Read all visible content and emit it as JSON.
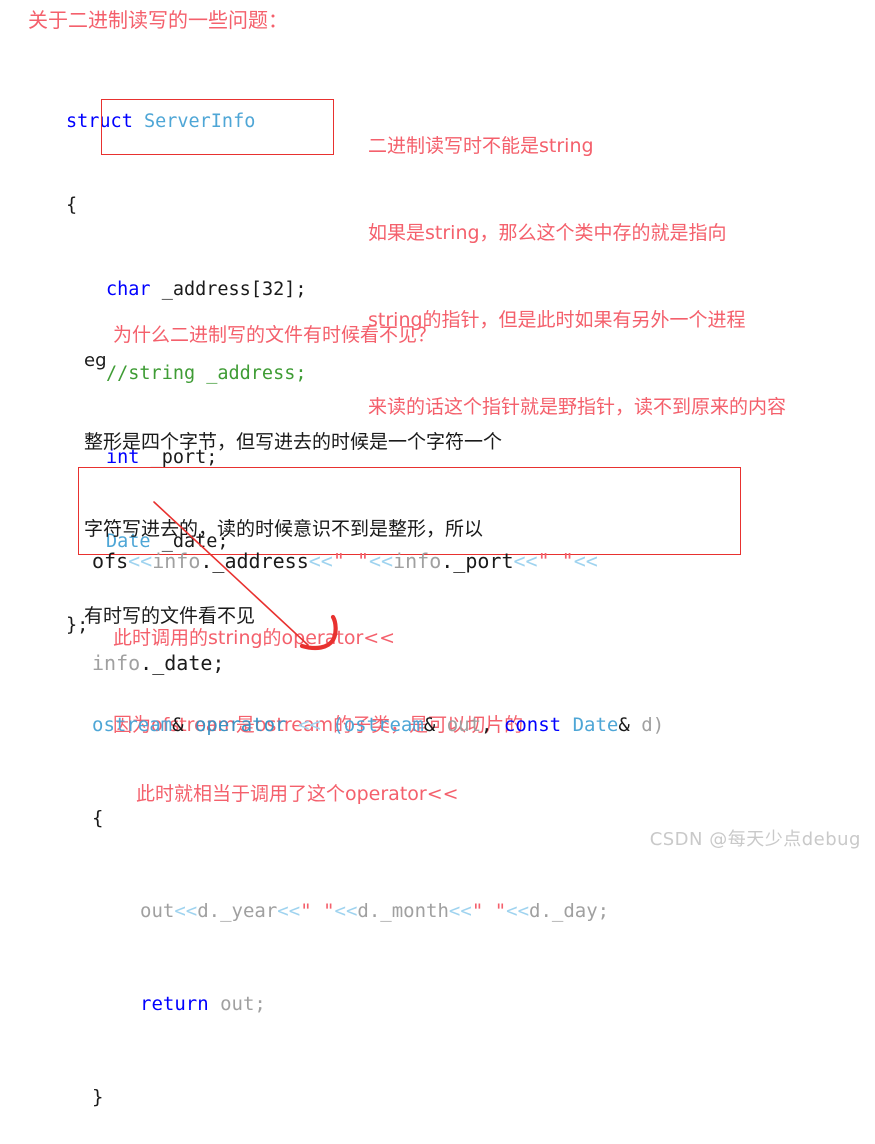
{
  "page": {
    "background": "#ffffff",
    "title_note": "关于二进制读写的一些问题："
  },
  "colors": {
    "annotation_red": "#f4606c",
    "box_red": "#e8312f",
    "keyword_blue": "#0000ff",
    "type_teal": "#4ea6d6",
    "comment_green": "#3f9c35",
    "operator_blue": "#9fd3ef",
    "identifier_gray": "#a0a0a0",
    "watermark_gray": "#c9c9c9"
  },
  "struct_block": {
    "line1": {
      "keyword": "struct",
      "space": " ",
      "type": "ServerInfo"
    },
    "line2": "{",
    "line3": {
      "keyword": "char",
      "rest": " _address[32];"
    },
    "line4": {
      "comment": "//string _address;"
    },
    "line5": {
      "keyword": "int",
      "rest": " _port;"
    },
    "line6": {
      "type": "Date",
      "rest": " _date;"
    },
    "line7": "};"
  },
  "note_right": {
    "lines": [
      "二进制读写时不能是string",
      "如果是string，那么这个类中存的就是指向",
      "string的指针，但是此时如果有另外一个进程",
      "来读的话这个指针就是野指针，读不到原来的内容"
    ]
  },
  "note_middle": {
    "question": "为什么二进制写的文件有时候看不见？",
    "eg_label": "eg",
    "lines": [
      "整形是四个字节，但写进去的时候是一个字符一个",
      "字符写进去的，读的时候意识不到是整形，所以",
      "有时写的文件看不见"
    ]
  },
  "boxed_code": {
    "line1": {
      "ofs": "ofs",
      "op1": "<<",
      "obj1": "info",
      "mem1": "._address",
      "op2": "<<",
      "str1": "\" \"",
      "op3": "<<",
      "obj2": "info",
      "mem2": "._port",
      "op4": "<<",
      "str2": "\" \"",
      "op5": "<<"
    },
    "line2": {
      "obj3": "info",
      "mem3": "._date;"
    }
  },
  "note_below_box": {
    "lines": [
      "此时调用的string的operator<<",
      "因为ofstream是ostream的子类，是可以切片的"
    ]
  },
  "operator_code": {
    "signature": {
      "ret_type": "ostream",
      "amp1": "&",
      "sp1": " ",
      "operator_kw": "operator",
      "sp2": " ",
      "op_arrows": "<<",
      "paren_open": " (",
      "param_type1": "ostream",
      "amp2": "&",
      "param_name1": " out",
      "comma": ", ",
      "const_kw": "const",
      "sp3": " ",
      "param_type2": "Date",
      "amp3": "&",
      "param_name2": " d",
      "paren_close": ")"
    },
    "brace_open": "{",
    "body_line": {
      "out": "out",
      "op1": "<<",
      "v1": "d._year",
      "op2": "<<",
      "str1": "\" \"",
      "op3": "<<",
      "v2": "d._month",
      "op4": "<<",
      "str2": "\" \"",
      "op5": "<<",
      "v3": "d._day;"
    },
    "return_line": {
      "keyword": "return",
      "value": " out;"
    },
    "brace_close": "}"
  },
  "note_bottom": {
    "text": "此时就相当于调用了这个operator<<"
  },
  "watermark": {
    "text": "CSDN @每天少点debug"
  }
}
